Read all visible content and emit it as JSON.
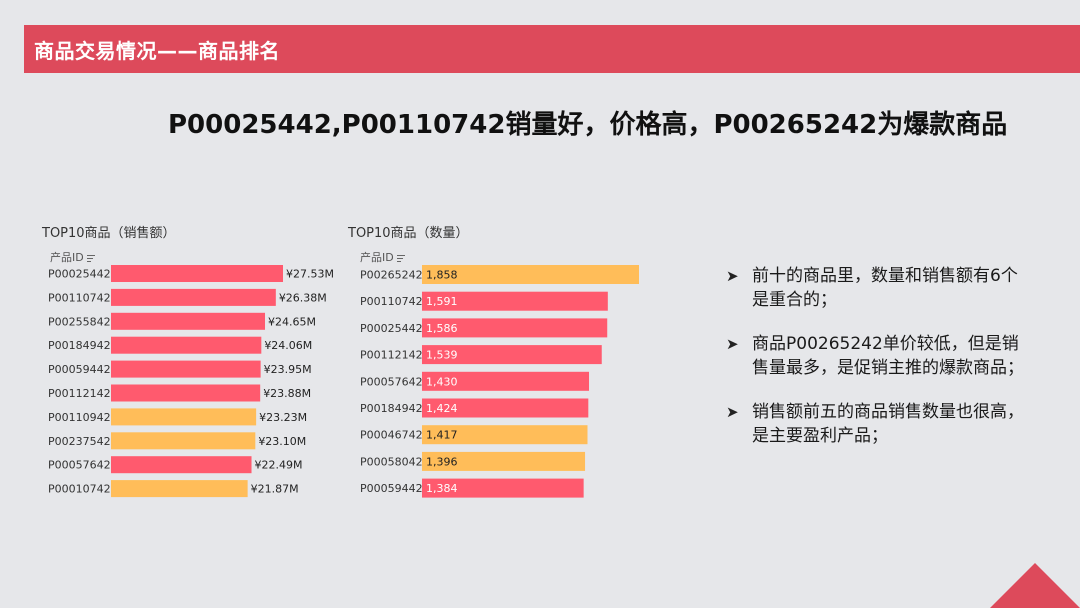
{
  "banner": {
    "title": "商品交易情况——商品排名"
  },
  "headline": "P00025442,P00110742销量好，价格高，P00265242为爆款商品",
  "colors": {
    "accent": "#dd4a5b",
    "bar_red": "#ff5a6e",
    "bar_orange": "#ffbd59"
  },
  "chart_data": [
    {
      "type": "bar",
      "orientation": "horizontal",
      "title": "TOP10商品（销售额）",
      "category_header": "产品ID",
      "categories": [
        "P00025442",
        "P00110742",
        "P00255842",
        "P00184942",
        "P00059442",
        "P00112142",
        "P00110942",
        "P00237542",
        "P00057642",
        "P00010742"
      ],
      "values": [
        27.53,
        26.38,
        24.65,
        24.06,
        23.95,
        23.88,
        23.23,
        23.1,
        22.49,
        21.87
      ],
      "labels": [
        "¥27.53M",
        "¥26.38M",
        "¥24.65M",
        "¥24.06M",
        "¥23.95M",
        "¥23.88M",
        "¥23.23M",
        "¥23.10M",
        "¥22.49M",
        "¥21.87M"
      ],
      "colors": [
        "red",
        "red",
        "red",
        "red",
        "red",
        "red",
        "orange",
        "orange",
        "red",
        "orange"
      ],
      "label_position": "outside"
    },
    {
      "type": "bar",
      "orientation": "horizontal",
      "title": "TOP10商品（数量）",
      "category_header": "产品ID",
      "categories": [
        "P00265242",
        "P00110742",
        "P00025442",
        "P00112142",
        "P00057642",
        "P00184942",
        "P00046742",
        "P00058042",
        "P00059442"
      ],
      "values": [
        1858,
        1591,
        1586,
        1539,
        1430,
        1424,
        1417,
        1396,
        1384
      ],
      "labels": [
        "1,858",
        "1,591",
        "1,586",
        "1,539",
        "1,430",
        "1,424",
        "1,417",
        "1,396",
        "1,384"
      ],
      "colors": [
        "orange",
        "red",
        "red",
        "red",
        "red",
        "red",
        "orange",
        "orange",
        "red"
      ],
      "label_position": "inside"
    }
  ],
  "bullets": [
    "前十的商品里，数量和销售额有6个是重合的；",
    "商品P00265242单价较低，但是销售量最多，是促销主推的爆款商品；",
    "销售额前五的商品销售数量也很高，是主要盈利产品；"
  ],
  "bullet_symbol": "➤"
}
